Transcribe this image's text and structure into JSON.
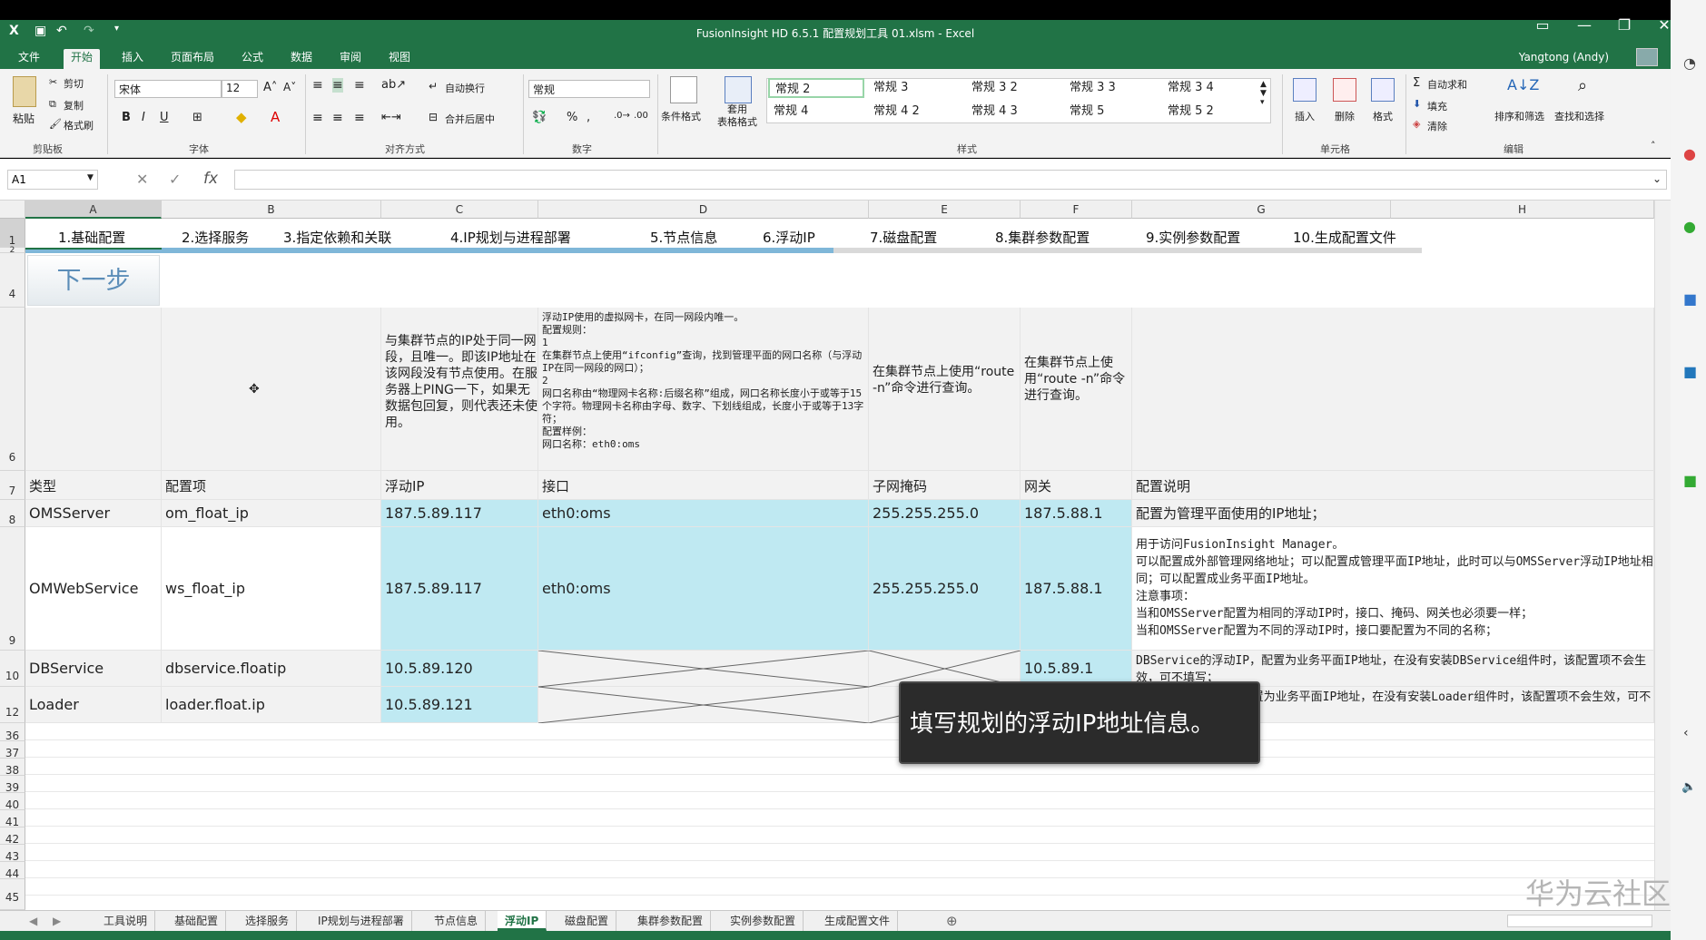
{
  "window": {
    "title": "FusionInsight HD 6.5.1 配置规划工具 01.xlsm - Excel",
    "user": "Yangtong (Andy)"
  },
  "ribbon_tabs": [
    "文件",
    "开始",
    "插入",
    "页面布局",
    "公式",
    "数据",
    "审阅",
    "视图"
  ],
  "ribbon": {
    "clipboard": {
      "paste": "粘贴",
      "cut": "剪切",
      "copy": "复制",
      "format_painter": "格式刷",
      "label": "剪贴板"
    },
    "font": {
      "name": "宋体",
      "size": "12",
      "label": "字体",
      "bold": "B",
      "italic": "I",
      "underline": "U"
    },
    "align": {
      "wrap": "自动换行",
      "merge": "合并后居中",
      "label": "对齐方式"
    },
    "number": {
      "format": "常规",
      "percent": "%",
      "comma": ",",
      "label": "数字"
    },
    "styles": {
      "cond": "条件格式",
      "table": "套用\n表格格式",
      "items": [
        "常规 2",
        "常规 3",
        "常规 3 2",
        "常规 3 3",
        "常规 3 4",
        "常规 4",
        "常规 4 2",
        "常规 4 3",
        "常规 5",
        "常规 5 2"
      ],
      "label": "样式"
    },
    "cells": {
      "insert": "插入",
      "delete": "删除",
      "format": "格式",
      "label": "单元格"
    },
    "edit": {
      "autosum": "自动求和",
      "fill": "填充",
      "clear": "清除",
      "sort": "排序和筛选",
      "find": "查找和选择",
      "label": "编辑"
    }
  },
  "formula_bar": {
    "name_box": "A1",
    "fx": "fx",
    "content": ""
  },
  "columns": [
    "A",
    "B",
    "C",
    "D",
    "E",
    "F",
    "G",
    "H"
  ],
  "rows": [
    "1",
    "2",
    "4",
    "6",
    "7",
    "8",
    "9",
    "10",
    "12",
    "36",
    "37",
    "38",
    "39",
    "40",
    "41",
    "42",
    "43",
    "44",
    "45"
  ],
  "steps": [
    "1.基础配置",
    "2.选择服务",
    "3.指定依赖和关联",
    "4.IP规划与进程部署",
    "5.节点信息",
    "6.浮动IP",
    "7.磁盘配置",
    "8.集群参数配置",
    "9.实例参数配置",
    "10.生成配置文件"
  ],
  "next_button": "下一步",
  "notes": {
    "c": "与集群节点的IP处于同一网段，且唯一。即该IP地址在该网段没有节点使用。在服务器上PING一下，如果无数据包回复，则代表还未使用。",
    "d": "浮动IP使用的虚拟网卡，在同一网段内唯一。\n配置规则：\n1\n在集群节点上使用“ifconfig”查询，找到管理平面的网口名称（与浮动IP在同一网段的网口）；\n2\n网口名称由“物理网卡名称:后缀名称”组成，网口名称长度小于或等于15个字符。物理网卡名称由字母、数字、下划线组成，长度小于或等于13字符；\n配置样例：\n网口名称：eth0:oms",
    "e": "在集群节点上使用“route -n”命令进行查询。",
    "f": "在集群节点上使用“route -n”命令进行查询。"
  },
  "headers": [
    "类型",
    "配置项",
    "浮动IP",
    "接口",
    "子网掩码",
    "网关",
    "配置说明"
  ],
  "table": [
    {
      "type": "OMSServer",
      "item": "om_float_ip",
      "ip": "187.5.89.117",
      "iface": "eth0:oms",
      "mask": "255.255.255.0",
      "gw": "187.5.88.1",
      "desc": "配置为管理平面使用的IP地址；"
    },
    {
      "type": "OMWebService",
      "item": "ws_float_ip",
      "ip": "187.5.89.117",
      "iface": "eth0:oms",
      "mask": "255.255.255.0",
      "gw": "187.5.88.1",
      "desc": "用于访问FusionInsight Manager。\n可以配置成外部管理网络地址；可以配置成管理平面IP地址，此时可以与OMSServer浮动IP地址相同；可以配置成业务平面IP地址。\n注意事项：\n当和OMSServer配置为相同的浮动IP时，接口、掩码、网关也必须要一样；\n当和OMSServer配置为不同的浮动IP时，接口要配置为不同的名称；"
    },
    {
      "type": "DBService",
      "item": "dbservice.floatip",
      "ip": "10.5.89.120",
      "iface": "",
      "mask": "",
      "gw": "10.5.89.1",
      "desc": "DBService的浮动IP，配置为业务平面IP地址，在没有安装DBService组件时，该配置项不会生效，可不填写；"
    },
    {
      "type": "Loader",
      "item": "loader.float.ip",
      "ip": "10.5.89.121",
      "iface": "",
      "mask": "",
      "gw": "",
      "desc": "Loader的浮动IP，配置为业务平面IP地址，在没有安装Loader组件时，该配置项不会生效，可不填写；"
    }
  ],
  "sheet_tabs": [
    "工具说明",
    "基础配置",
    "选择服务",
    "IP规划与进程部署",
    "节点信息",
    "浮动IP",
    "磁盘配置",
    "集群参数配置",
    "实例参数配置",
    "生成配置文件"
  ],
  "tooltip": "填写规划的浮动IP地址信息。",
  "watermark": "华为云社区"
}
